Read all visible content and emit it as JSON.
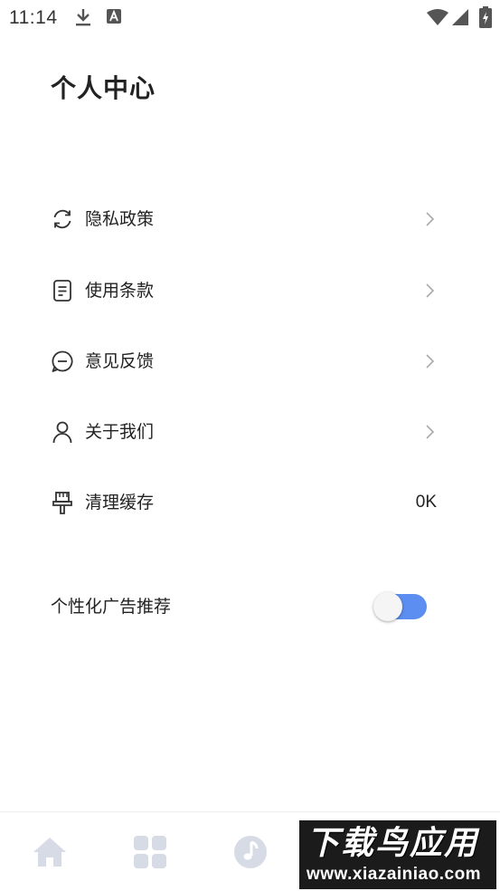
{
  "status_bar": {
    "time": "11:14",
    "icons": [
      "download-icon",
      "a-notification-icon",
      "wifi-icon",
      "signal-icon",
      "battery-icon"
    ]
  },
  "page": {
    "title": "个人中心"
  },
  "menu": [
    {
      "label": "隐私政策",
      "icon": "refresh-icon",
      "chevron": true
    },
    {
      "label": "使用条款",
      "icon": "document-icon",
      "chevron": true
    },
    {
      "label": "意见反馈",
      "icon": "chat-bubble-icon",
      "chevron": true
    },
    {
      "label": "关于我们",
      "icon": "person-icon",
      "chevron": true
    },
    {
      "label": "清理缓存",
      "icon": "brush-icon",
      "value": "0K"
    }
  ],
  "ad_setting": {
    "label": "个性化广告推荐",
    "enabled": true,
    "toggle_color": "#5b8ef0"
  },
  "bottom_nav": {
    "items": [
      "home-icon",
      "grid-icon",
      "music-note-icon",
      "profile-icon"
    ],
    "inactive_color": "#d6dbe6",
    "active_color": "#5b8ef0"
  },
  "watermark": {
    "title": "下载鸟应用",
    "url": "www.xiazainiao.com"
  }
}
